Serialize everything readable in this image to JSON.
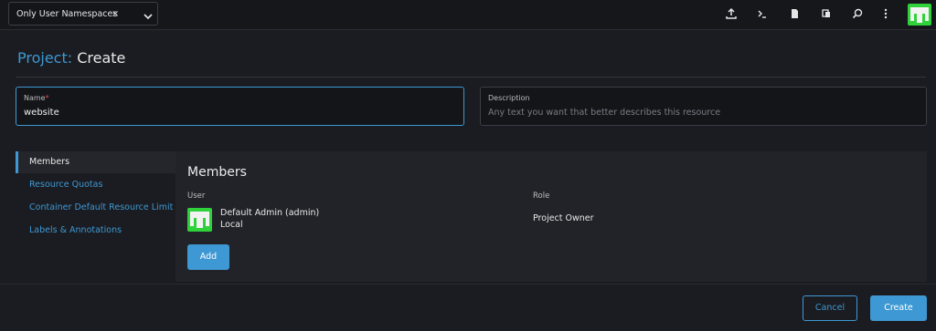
{
  "header": {
    "namespace_filter": {
      "chip_label": "Only User Namespaces",
      "chip_remove": "×"
    },
    "tools": [
      "import-yaml-icon",
      "kubectl-shell-icon",
      "kubeconfig-file-icon",
      "copy-kubeconfig-icon",
      "resource-search-icon",
      "more-actions-icon"
    ],
    "brand_color": "#2fd23b"
  },
  "page": {
    "title_prefix": "Project:",
    "title_suffix": "Create"
  },
  "form": {
    "name": {
      "label": "Name",
      "required_mark": "*",
      "value": "website"
    },
    "description": {
      "label": "Description",
      "placeholder": "Any text you want that better describes this resource"
    }
  },
  "tabs": [
    {
      "label": "Members",
      "active": true
    },
    {
      "label": "Resource Quotas",
      "active": false
    },
    {
      "label": "Container Default Resource Limit",
      "active": false
    },
    {
      "label": "Labels & Annotations",
      "active": false
    }
  ],
  "members": {
    "title": "Members",
    "columns": {
      "user": "User",
      "role": "Role"
    },
    "rows": [
      {
        "name": "Default Admin (admin)",
        "provider": "Local",
        "role": "Project Owner"
      }
    ],
    "add_label": "Add"
  },
  "footer": {
    "cancel_label": "Cancel",
    "create_label": "Create"
  },
  "colors": {
    "accent": "#3d98d3",
    "background": "#1b1c21",
    "panel": "#222329",
    "required": "#e5484d"
  }
}
